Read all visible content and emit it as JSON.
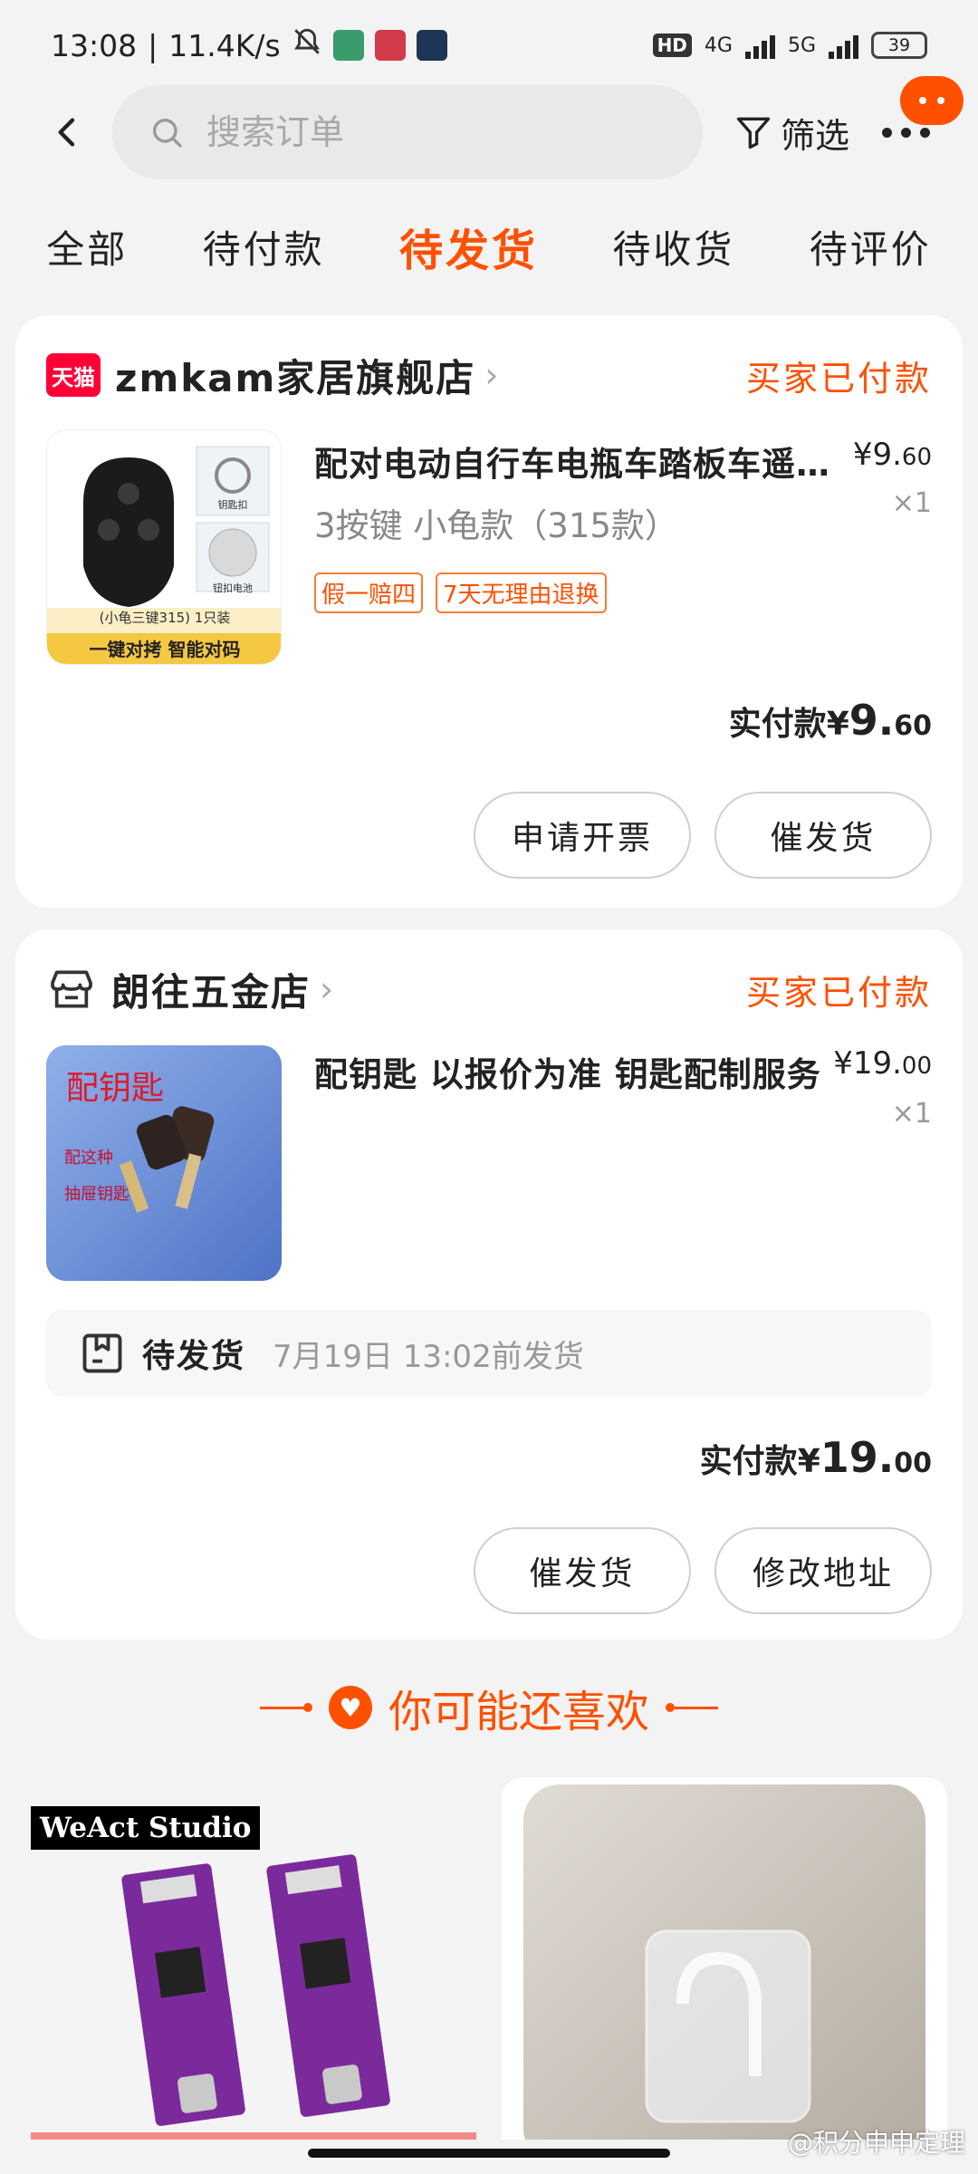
{
  "status_bar": {
    "time": "13:08",
    "speed": "11.4K/s",
    "net1": "4G",
    "net2": "5G",
    "hd": "HD",
    "battery": "39"
  },
  "header": {
    "search_placeholder": "搜索订单",
    "filter_label": "筛选"
  },
  "tabs": [
    {
      "label": "全部",
      "active": false
    },
    {
      "label": "待付款",
      "active": false
    },
    {
      "label": "待发货",
      "active": true
    },
    {
      "label": "待收货",
      "active": false
    },
    {
      "label": "待评价",
      "active": false
    }
  ],
  "orders": [
    {
      "shop_badge": "天猫",
      "shop_name": "zmkam家居旗舰店",
      "status": "买家已付款",
      "product_title": "配对电动自行车电瓶车踏板车遥控器",
      "sku": "3按键 小龟款（315款）",
      "price_main": "¥9.",
      "price_dec": "60",
      "qty": "×1",
      "tags": [
        "假一赔四",
        "7天无理由退换"
      ],
      "thumb_caption_1": "(小龟三键315) 1只装",
      "thumb_caption_2": "一键对拷 智能对码",
      "thumb_label_a": "钥匙扣",
      "thumb_label_b": "钮扣电池",
      "paid_label": "实付款",
      "paid_cur": "¥",
      "paid_main": "9.",
      "paid_dec": "60",
      "buttons": [
        "申请开票",
        "催发货"
      ]
    },
    {
      "shop_name": "朗往五金店",
      "status": "买家已付款",
      "product_title": "配钥匙 以报价为准 钥匙配制服务",
      "price_main": "¥19.",
      "price_dec": "00",
      "qty": "×1",
      "thumb_title": "配钥匙",
      "thumb_sub1": "配这种",
      "thumb_sub2": "抽屉钥匙",
      "ship_label": "待发货",
      "ship_time": "7月19日 13:02前发货",
      "paid_label": "实付款",
      "paid_cur": "¥",
      "paid_main": "19.",
      "paid_dec": "00",
      "buttons": [
        "催发货",
        "修改地址"
      ]
    }
  ],
  "recommend": {
    "title": "你可能还喜欢",
    "item1_brand": "WeAct Studio"
  },
  "watermark": "@积分申申定理",
  "colors": {
    "accent": "#ff5000",
    "tmall": "#ff0036"
  }
}
